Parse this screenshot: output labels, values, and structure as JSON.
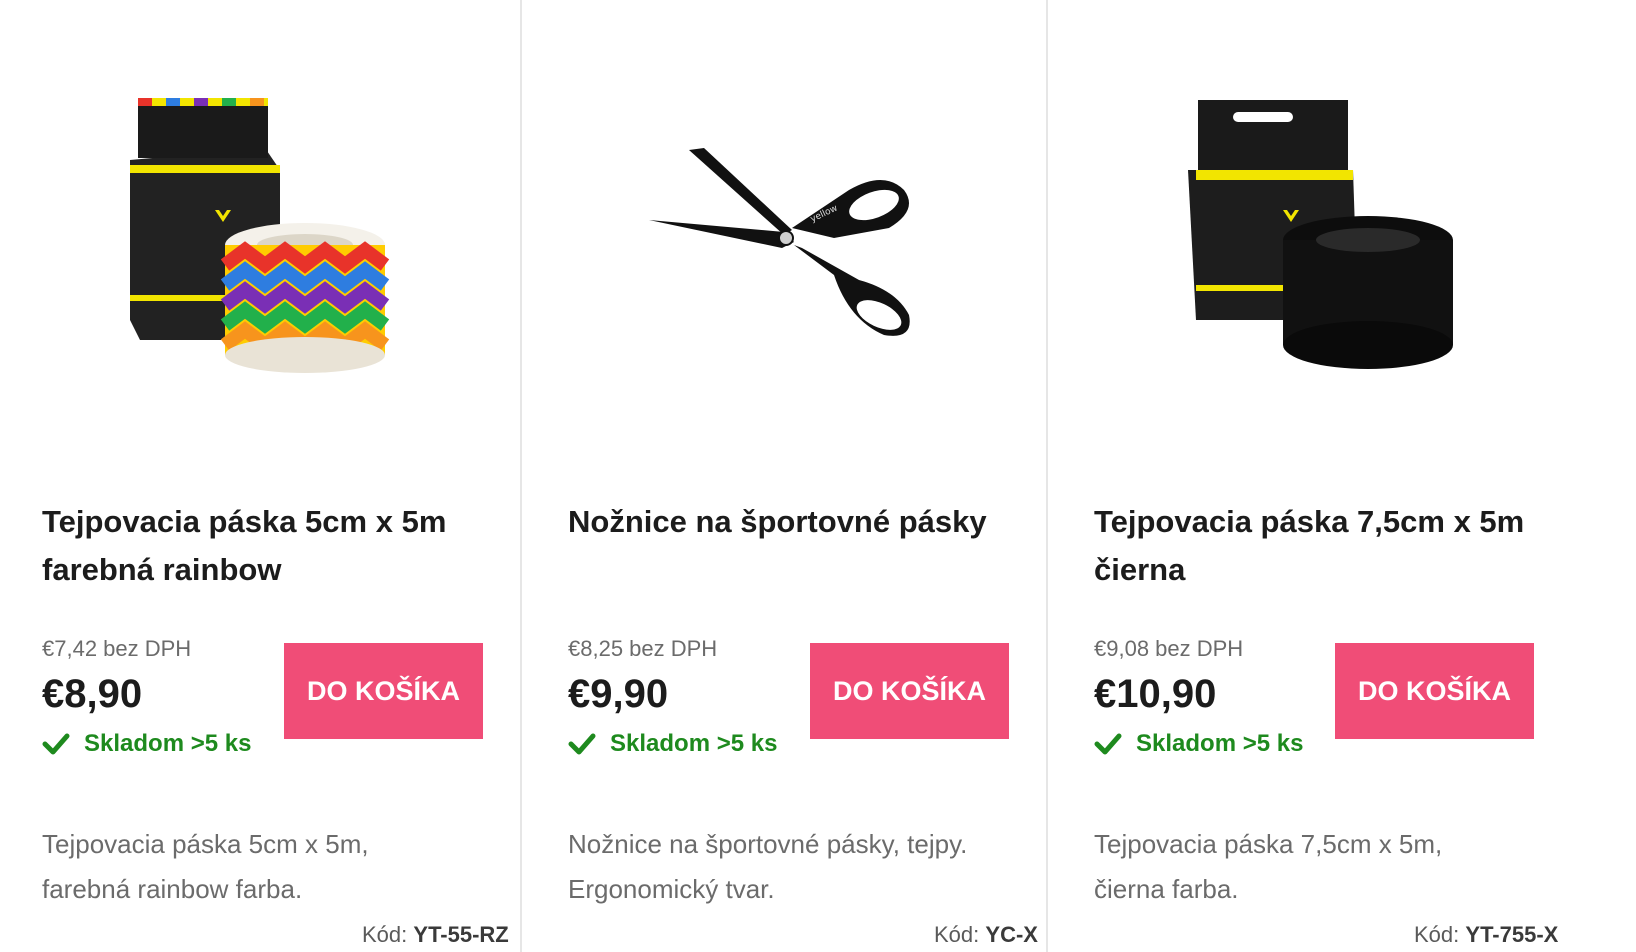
{
  "products": [
    {
      "title": "Tejpovacia páska 5cm x 5m farebná rainbow",
      "net_price": "€7,42 bez DPH",
      "price": "€8,90",
      "stock": "Skladom >5 ks",
      "cart_label": "DO KOŠÍKA",
      "description": "Tejpovacia páska 5cm x 5m, farebná rainbow farba.",
      "code_label": "Kód:",
      "code_value": "YT-55-RZ",
      "image": "rainbow-tape-product-image"
    },
    {
      "title": "Nožnice na športovné pásky",
      "net_price": "€8,25 bez DPH",
      "price": "€9,90",
      "stock": "Skladom >5 ks",
      "cart_label": "DO KOŠÍKA",
      "description": "Nožnice na športovné pásky, tejpy. Ergonomický tvar.",
      "code_label": "Kód:",
      "code_value": "YC-X",
      "image": "scissors-product-image"
    },
    {
      "title": "Tejpovacia páska 7,5cm x 5m čierna",
      "net_price": "€9,08 bez DPH",
      "price": "€10,90",
      "stock": "Skladom >5 ks",
      "cart_label": "DO KOŠÍKA",
      "description": "Tejpovacia páska 7,5cm x 5m, čierna farba.",
      "code_label": "Kód:",
      "code_value": "YT-755-X",
      "image": "black-tape-product-image"
    }
  ],
  "colors": {
    "cart_button": "#f04d77",
    "stock_green": "#1e8a1e",
    "brand_yellow": "#f2e500"
  }
}
